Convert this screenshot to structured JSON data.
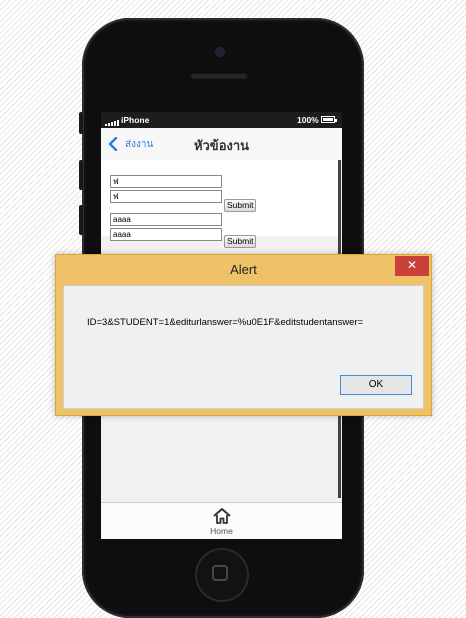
{
  "status_bar": {
    "carrier": "iPhone",
    "battery": "100%"
  },
  "nav_bar": {
    "back_label": "ส่งงาน",
    "title": "หัวข้องาน"
  },
  "form1": {
    "field1_value": "ฟ",
    "field2_value": "ฟ",
    "submit_label": "Submit"
  },
  "form2": {
    "field1_value": "aaaa",
    "field2_value": "aaaa",
    "submit_label": "Submit"
  },
  "tab_bar": {
    "home_label": "Home",
    "home_icon": "home-icon"
  },
  "alert": {
    "title": "Alert",
    "close_icon": "close-icon",
    "close_glyph": "✕",
    "message": "ID=3&STUDENT=1&editurlanswer=%u0E1F&editstudentanswer=",
    "ok_label": "OK"
  },
  "colors": {
    "alert_frame": "#f0c268",
    "close_button": "#c9413a",
    "ios_blue": "#2f7fd8",
    "ok_border": "#3c8fdc"
  }
}
